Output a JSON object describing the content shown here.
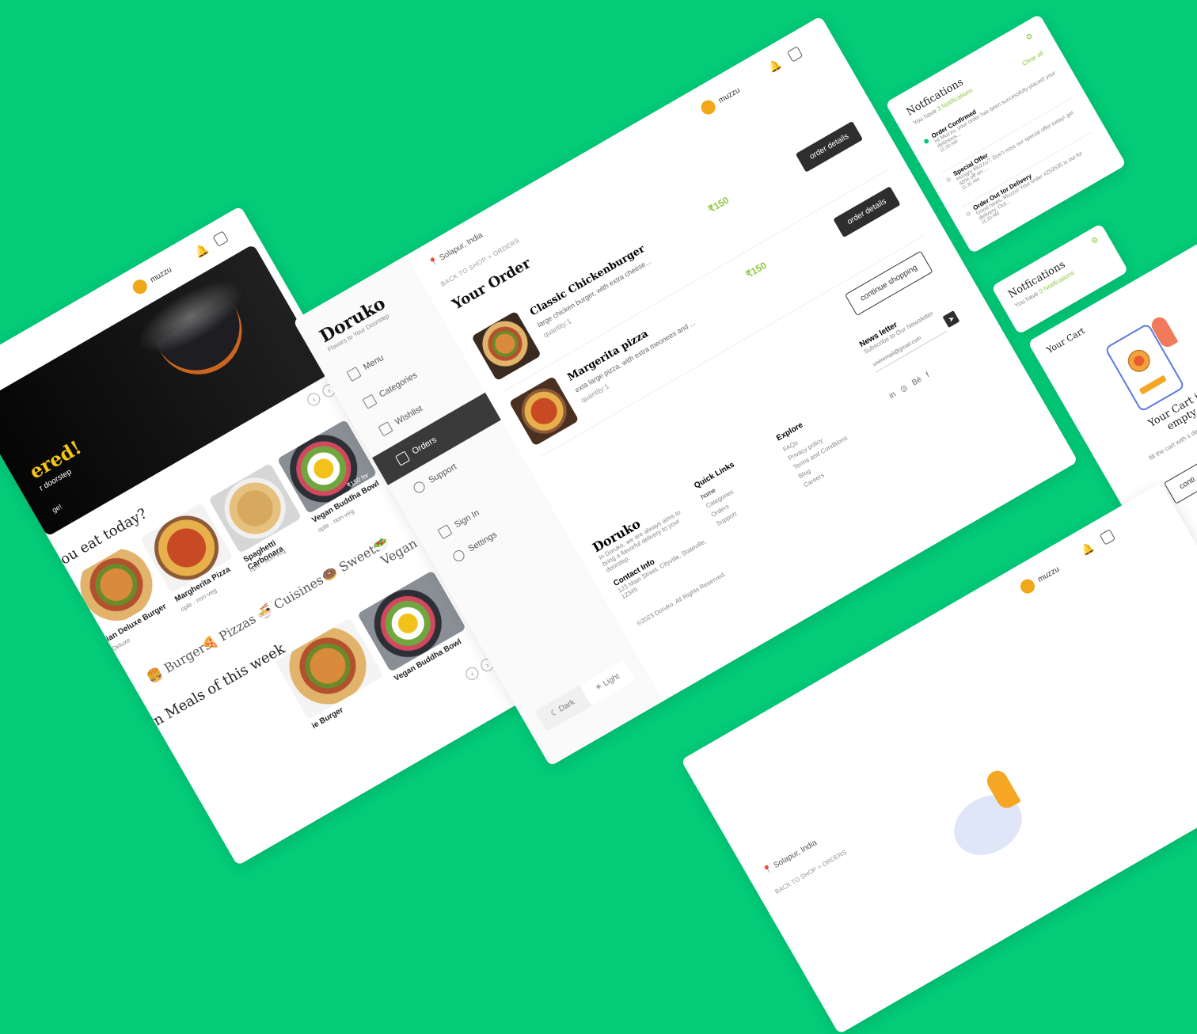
{
  "brand": {
    "name": "Doruko",
    "tagline": "Flavors to Your Doorstep"
  },
  "user": {
    "name": "muzzu"
  },
  "location": "Solapur, India",
  "breadcrumb": {
    "back": "BACK TO SHOP",
    "sep": ">",
    "current": "ORDERS"
  },
  "sidebar": {
    "items": [
      {
        "label": "Menu"
      },
      {
        "label": "Categories"
      },
      {
        "label": "Wishlist"
      },
      {
        "label": "Orders"
      },
      {
        "label": "Support"
      }
    ],
    "signin": "Sign In",
    "settings": "Settings",
    "theme_dark": "Dark",
    "theme_light": "Light"
  },
  "orders": {
    "title": "Your Order",
    "details_label": "order details",
    "continue_label": "continue shopping",
    "items": [
      {
        "name": "Classic Chickenburger",
        "desc": "large chicken burger, with extra cheese...",
        "qty": "quantity:1",
        "price": "₹150"
      },
      {
        "name": "Margerita pizza",
        "desc": "exta large pizza,  with  extra meonees and ...",
        "qty": "quantity:1",
        "price": "₹150"
      }
    ]
  },
  "newsletter": {
    "title": "News letter",
    "sub": "Subscribe to Our Newsletter",
    "placeholder": "useremail@gmail.com"
  },
  "footer": {
    "about": "In Doruko, we are always aims to bring a flavorful delivery to your doorstep.",
    "contact_title": "Contact Info",
    "contact_addr": "123 Main Street, Cityville, Stateville, 12345",
    "copyright": "©2023 Doruko. All Rights Reserved.",
    "quick_title": "Quick Links",
    "quick_links": [
      "home",
      "Categories",
      "Orders",
      "Support"
    ],
    "explore_title": "Explore",
    "explore_links": [
      "FAQs",
      "Privacy policy",
      "Terms and Conditions",
      "Blog",
      "Careers"
    ]
  },
  "notifications": {
    "title": "Notfications",
    "subtitle_prefix": "You have ",
    "count_text": "3 Notifications",
    "clear": "Clear all",
    "items": [
      {
        "title": "Order Confirmed",
        "body": "Hi Muzzu, your order has been successfully placed! your delicious...",
        "time": "11:30 AM"
      },
      {
        "title": "Special Offer",
        "body": "Hungry Muzzu?, Don't miss our special offer today! get 40% off on ...",
        "time": "11:30 AM"
      },
      {
        "title": "Order Out for Delivery",
        "body": "Good news, Muzzu! Your order #253535 is out for delivery. Out...",
        "time": "11:30 AM"
      }
    ]
  },
  "notifications_empty": {
    "title": "Notfications",
    "subtitle_prefix": "You have ",
    "count_text": "0 Notifications"
  },
  "cart": {
    "title": "Your Cart",
    "empty_title": "Your Cart is empty",
    "empty_body": "fill the cart with s delicious Doruko",
    "button": "conti"
  },
  "home": {
    "banner_headline": "ered!",
    "banner_sub": "r doorstep",
    "banner_extra": "ge!",
    "question": "ou eat today?",
    "weekly": "n Meals of this week",
    "categories": [
      "Burgers",
      "Pizzas",
      "Cuisines",
      "Sweets",
      "Vegan"
    ],
    "foods": [
      {
        "name": "ian Deluxe Burger",
        "meta": "Deluxe",
        "rating": "★4.5",
        "price": "₹150 for one"
      },
      {
        "name": "Margherita Pizza",
        "meta": "ople · non-veg",
        "rating": "★4.5",
        "price": "₹150 for one"
      },
      {
        "name": "Spaghetti Carbonara",
        "meta": "ople · non-veg",
        "rating": "★4.5",
        "price": "₹150 for one"
      },
      {
        "name": "Vegan Buddha Bowl",
        "meta": "ople · non-veg",
        "rating": "★4.5",
        "price": "₹150 for one"
      }
    ],
    "foods2": [
      {
        "name": "ie Burger",
        "price": "₹20 for one",
        "rating": "★4.5"
      },
      {
        "name": "Vegan Buddha Bowl",
        "meta": "ople · non-veg",
        "price": "₹150 for one",
        "rating": "★4.5"
      }
    ]
  },
  "colors": {
    "accent": "#03cb78",
    "dark": "#2e2e2e",
    "gold": "#f5c518"
  }
}
